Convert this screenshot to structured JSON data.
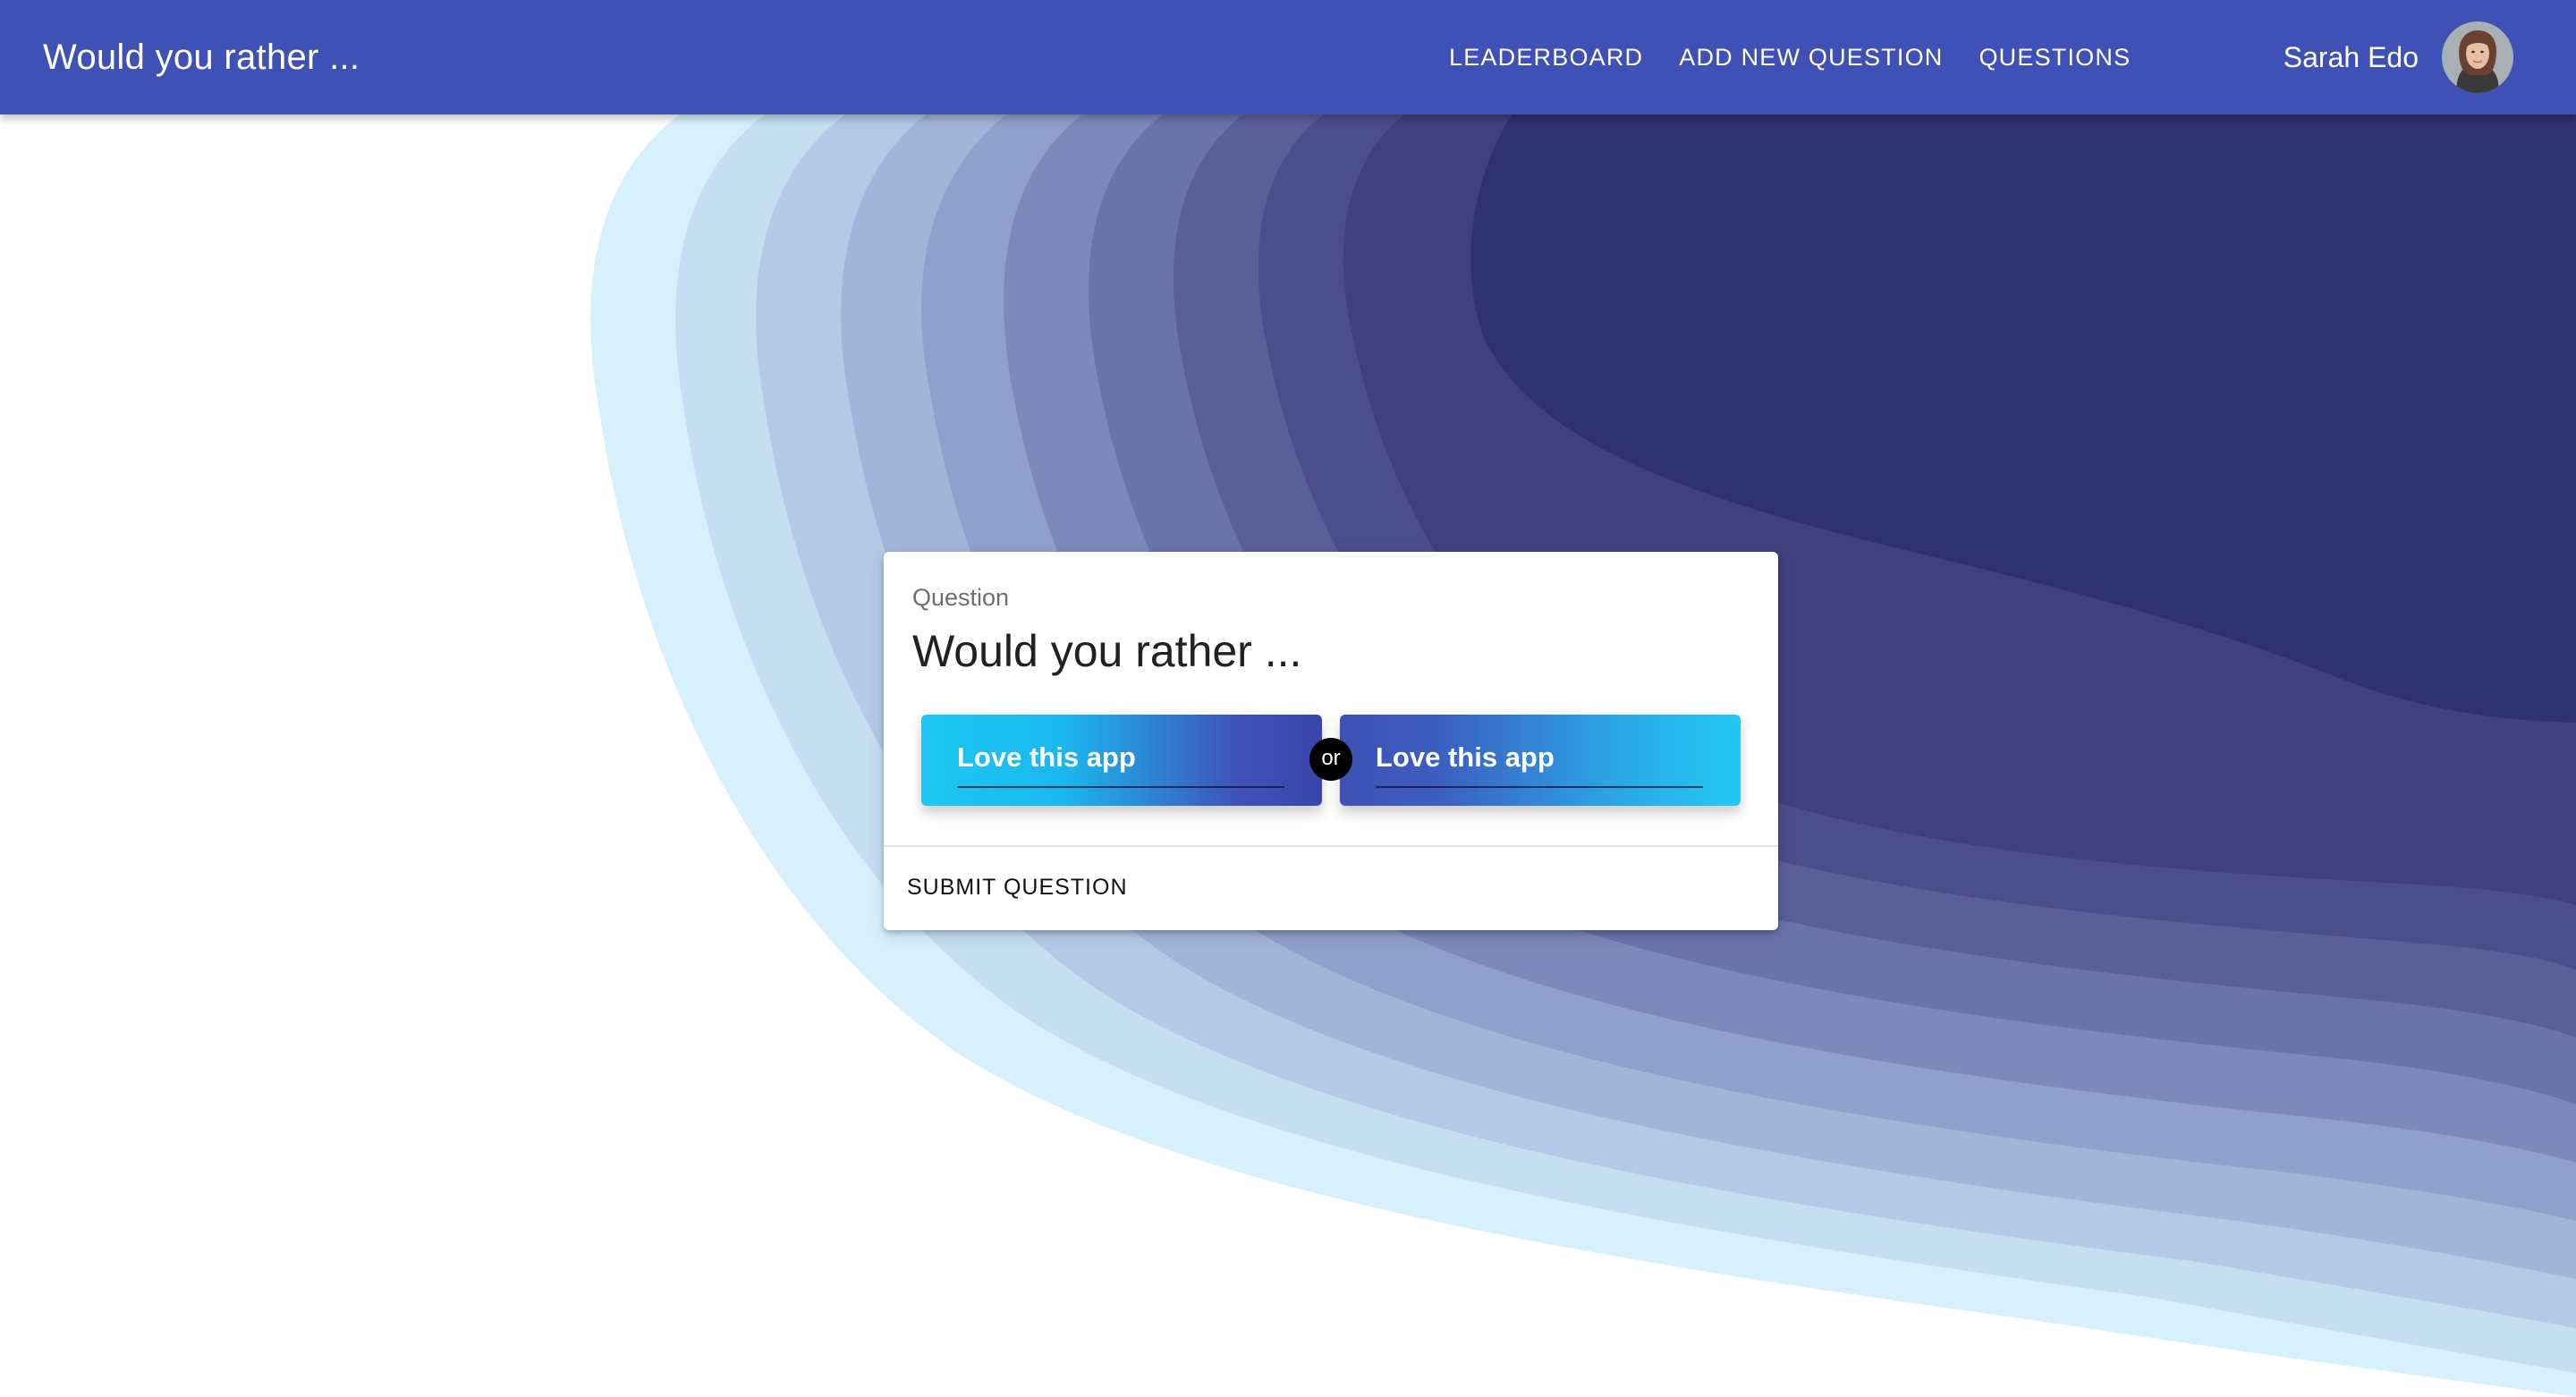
{
  "appbar": {
    "title": "Would you rather ...",
    "nav": [
      {
        "label": "LEADERBOARD"
      },
      {
        "label": "ADD NEW QUESTION"
      },
      {
        "label": "QUESTIONS"
      }
    ],
    "user": {
      "name": "Sarah Edo"
    }
  },
  "card": {
    "label": "Question",
    "title": "Would you rather ...",
    "option_one": "Love this app",
    "or_label": "or",
    "option_two": "Love this app",
    "submit_label": "SUBMIT QUESTION"
  },
  "colors": {
    "primary": "#3f51b5",
    "accent": "#22c9f4",
    "dark_wave": "#2f3271",
    "light_wave": "#d6f1fc"
  }
}
